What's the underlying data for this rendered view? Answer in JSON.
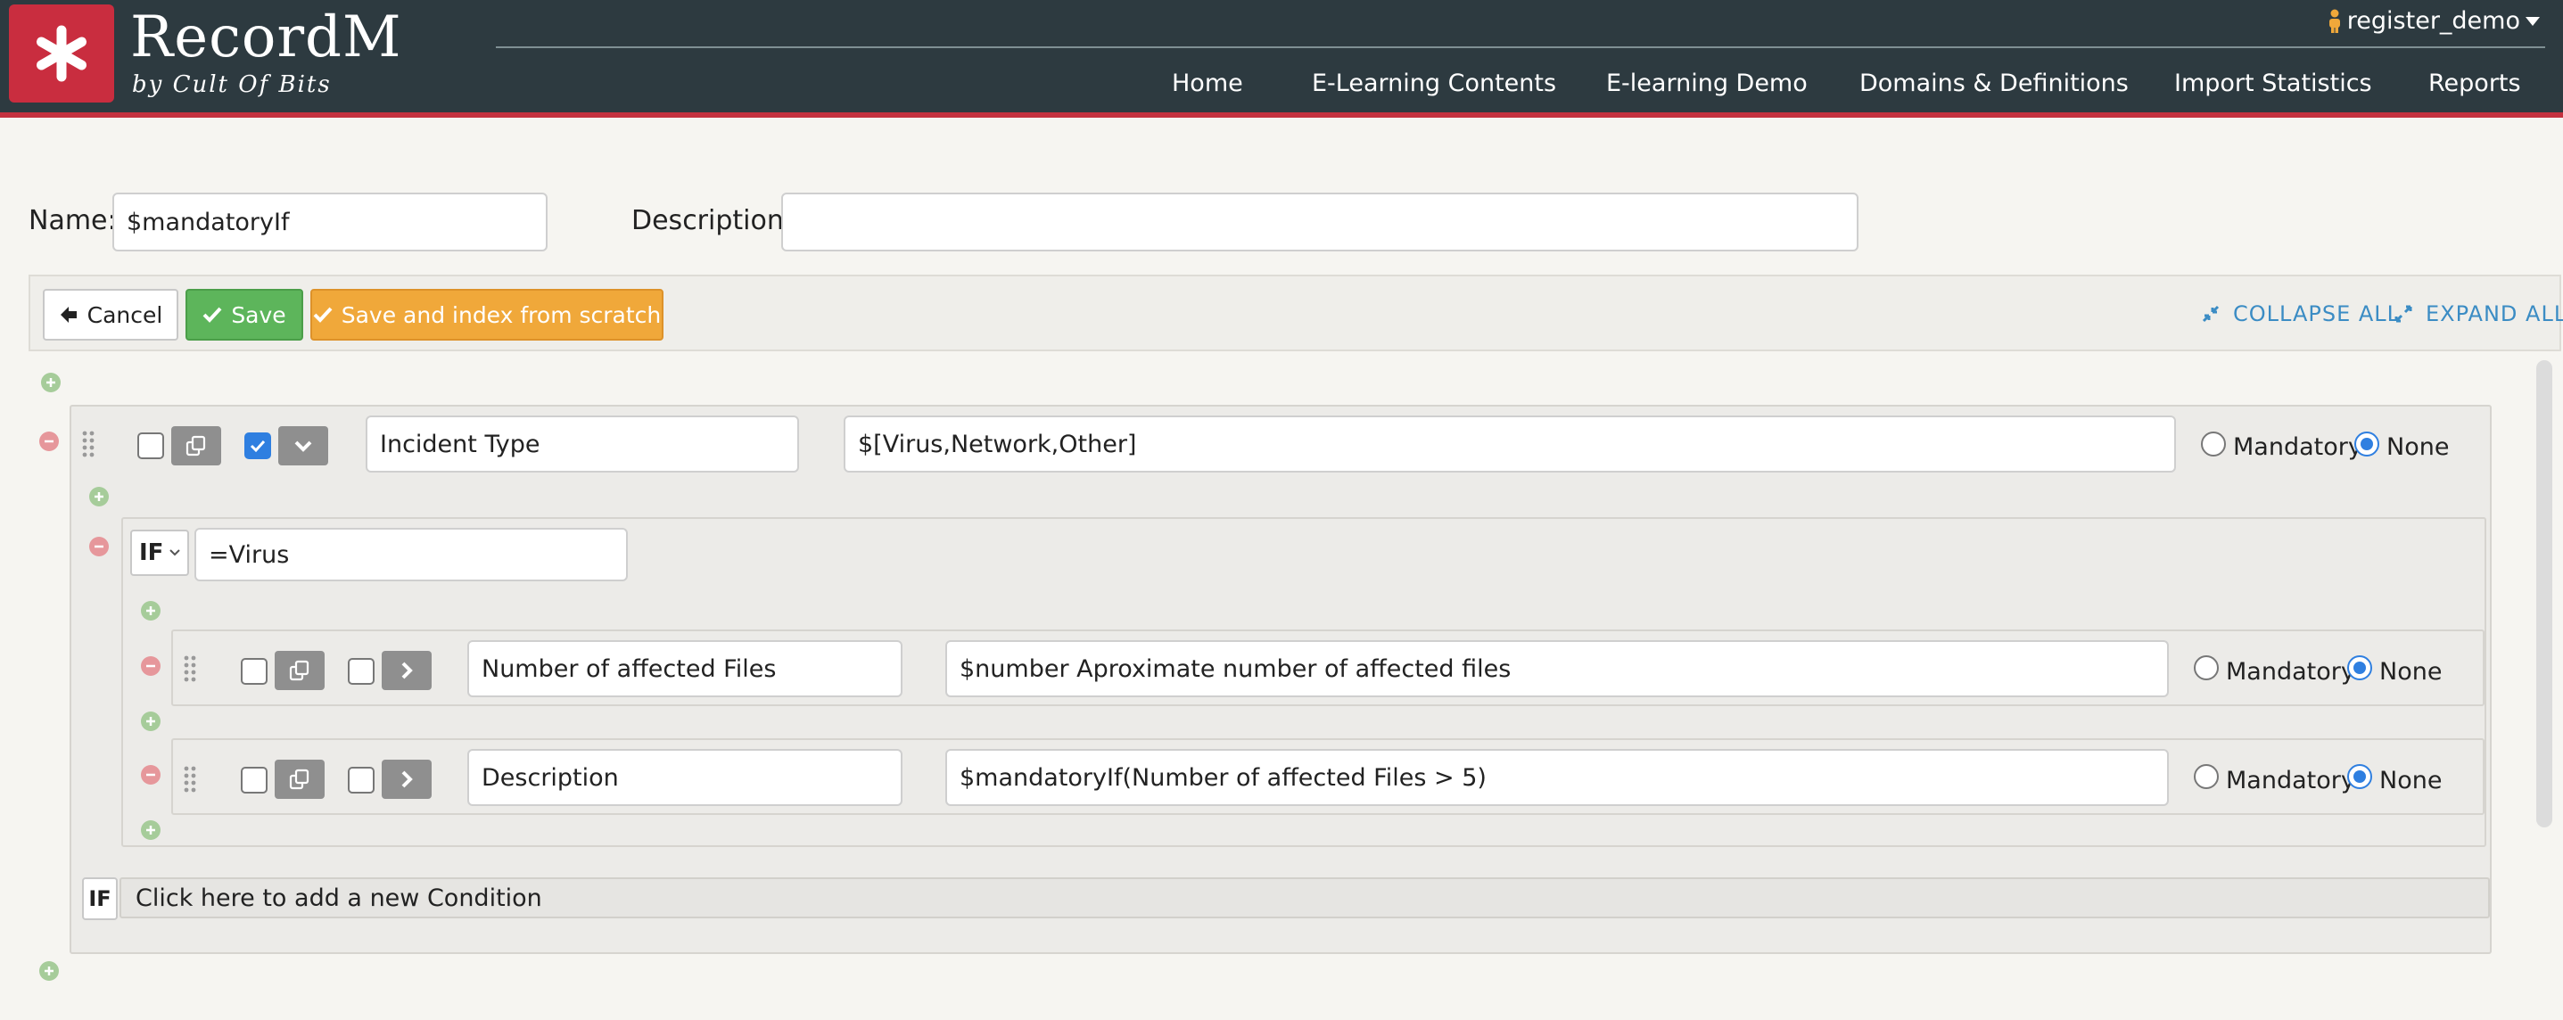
{
  "header": {
    "brand_title": "RecordM",
    "brand_subtitle": "by Cult Of Bits",
    "user": "register_demo",
    "nav": [
      {
        "label": "Home"
      },
      {
        "label": "E-Learning Contents"
      },
      {
        "label": "E-learning Demo"
      },
      {
        "label": "Domains & Definitions"
      },
      {
        "label": "Import Statistics"
      },
      {
        "label": "Reports"
      }
    ]
  },
  "form": {
    "name_label": "Name:",
    "name_value": "$mandatoryIf",
    "description_label": "Description:",
    "description_value": ""
  },
  "toolbar": {
    "cancel_label": "Cancel",
    "save_label": "Save",
    "save_index_label": "Save and index from scratch",
    "collapse_label": "COLLAPSE ALL",
    "expand_label": "EXPAND ALL"
  },
  "fields": {
    "root": {
      "name": "Incident Type",
      "description": "$[Virus,Network,Other]",
      "mandatory_label": "Mandatory",
      "none_label": "None",
      "selected": "None",
      "checkbox_checked": true
    },
    "condition": {
      "operator": "IF",
      "value": "=Virus"
    },
    "children": [
      {
        "name": "Number of affected Files",
        "description": "$number Aproximate number of affected files",
        "mandatory_label": "Mandatory",
        "none_label": "None",
        "selected": "None"
      },
      {
        "name": "Description",
        "description": "$mandatoryIf(Number of affected Files > 5)",
        "mandatory_label": "Mandatory",
        "none_label": "None",
        "selected": "None"
      }
    ],
    "add_condition_badge": "IF",
    "add_condition_label": "Click here to add a new Condition"
  },
  "colors": {
    "header_bg": "#2d3a40",
    "accent_red": "#c92d3f",
    "save_green": "#5db55b",
    "index_orange": "#f0a83a",
    "link_blue": "#3b8cc4",
    "radio_blue": "#2f7fe0"
  }
}
